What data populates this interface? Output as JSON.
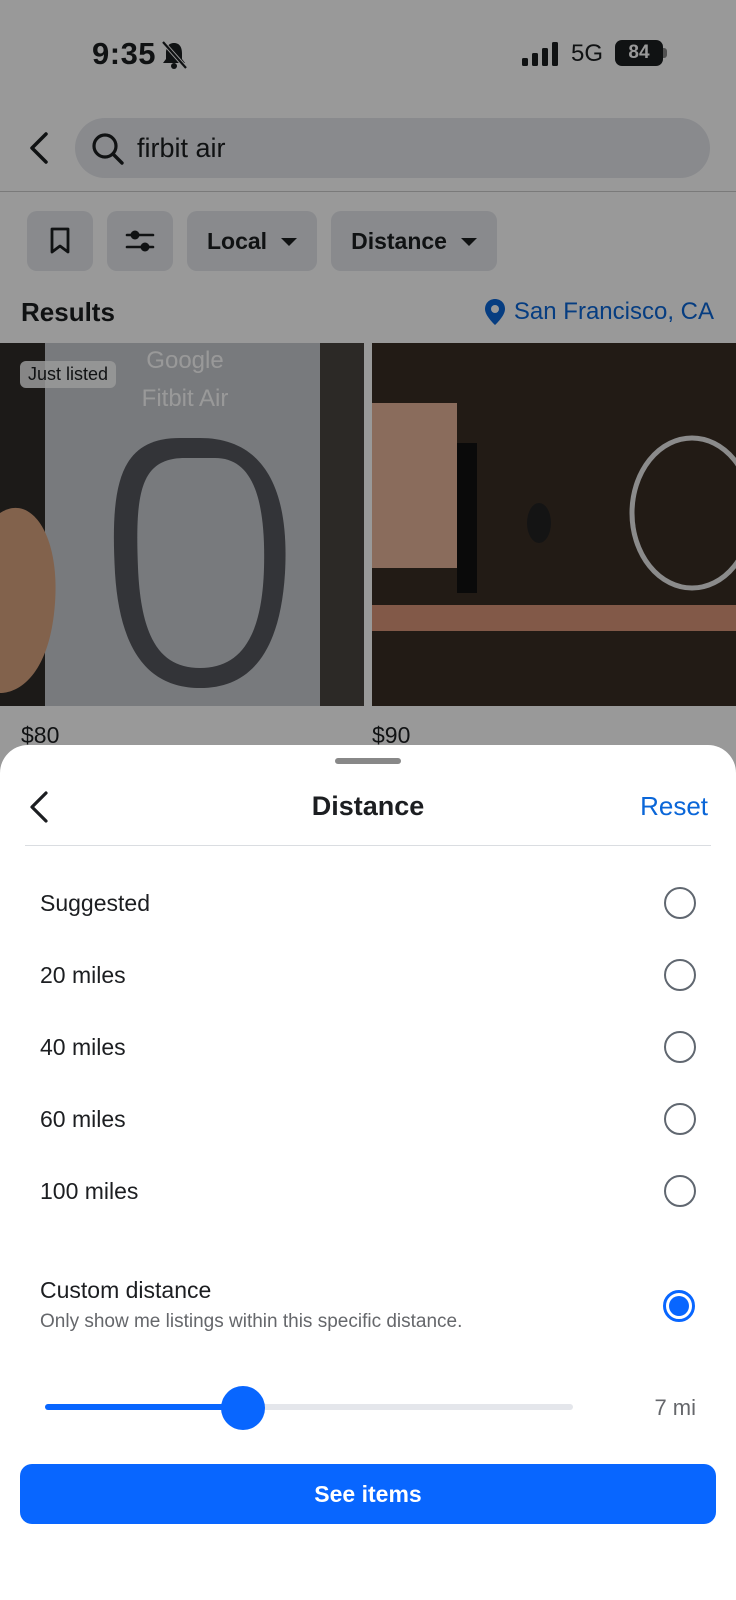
{
  "status_bar": {
    "time": "9:35",
    "network": "5G",
    "battery": "84"
  },
  "search": {
    "query": "firbit air"
  },
  "filters": {
    "local_label": "Local",
    "distance_label": "Distance"
  },
  "results": {
    "title": "Results",
    "location": "San Francisco, CA",
    "listings": [
      {
        "badge": "Just listed",
        "price": "$80",
        "image_text_1": "Google",
        "image_text_2": "Fitbit Air"
      },
      {
        "price": "$90"
      }
    ]
  },
  "sheet": {
    "title": "Distance",
    "reset_label": "Reset",
    "options": [
      {
        "label": "Suggested",
        "selected": false
      },
      {
        "label": "20 miles",
        "selected": false
      },
      {
        "label": "40 miles",
        "selected": false
      },
      {
        "label": "60 miles",
        "selected": false
      },
      {
        "label": "100 miles",
        "selected": false
      }
    ],
    "custom": {
      "title": "Custom distance",
      "subtitle": "Only show me listings within this specific distance.",
      "selected": true,
      "slider_fraction": 0.375,
      "value_label": "7 mi"
    },
    "see_items_label": "See items"
  },
  "colors": {
    "accent": "#0866ff",
    "link": "#0a66d8",
    "overlay": "rgba(0,0,0,0.4)"
  }
}
